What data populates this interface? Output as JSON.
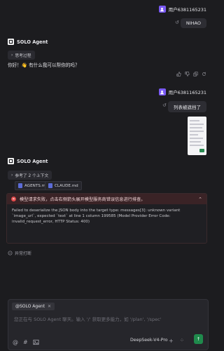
{
  "user": {
    "name": "用户6381165231"
  },
  "messages": {
    "first_user_text": "NIHAO",
    "agent_name": "SOLO Agent",
    "thinking_label": "思考过程",
    "agent_reply": "你好！👋 有什么我可以帮你的吗？",
    "second_user_text": "列表被遮挡了",
    "context_label": "参考了 2 个上下文",
    "files": [
      "AGENTS.md",
      "CLAUDE.md"
    ],
    "error_title": "模型请求失败，点击右侧箭头展开模型服务商错误信息进行排查。",
    "error_detail": "Failed to deserialize the JSON body into the target type: messages[3]: unknown variant `image_url`, expected `text` at line 1 column 199585 (Model Provider Error Code: invalid_request_error, HTTP Status: 400)",
    "interrupt_label": "异常打断"
  },
  "composer": {
    "mention": "@SOLO Agent",
    "placeholder": "您正在与 SOLO Agent 聊天。输入 '/' 获取更多能力，如 '/plan', '/spec'",
    "model": "DeepSeek-V4-Pro"
  },
  "colors": {
    "accent": "#7a5af5",
    "send": "#1f8a4c",
    "error": "#e24a4a"
  }
}
